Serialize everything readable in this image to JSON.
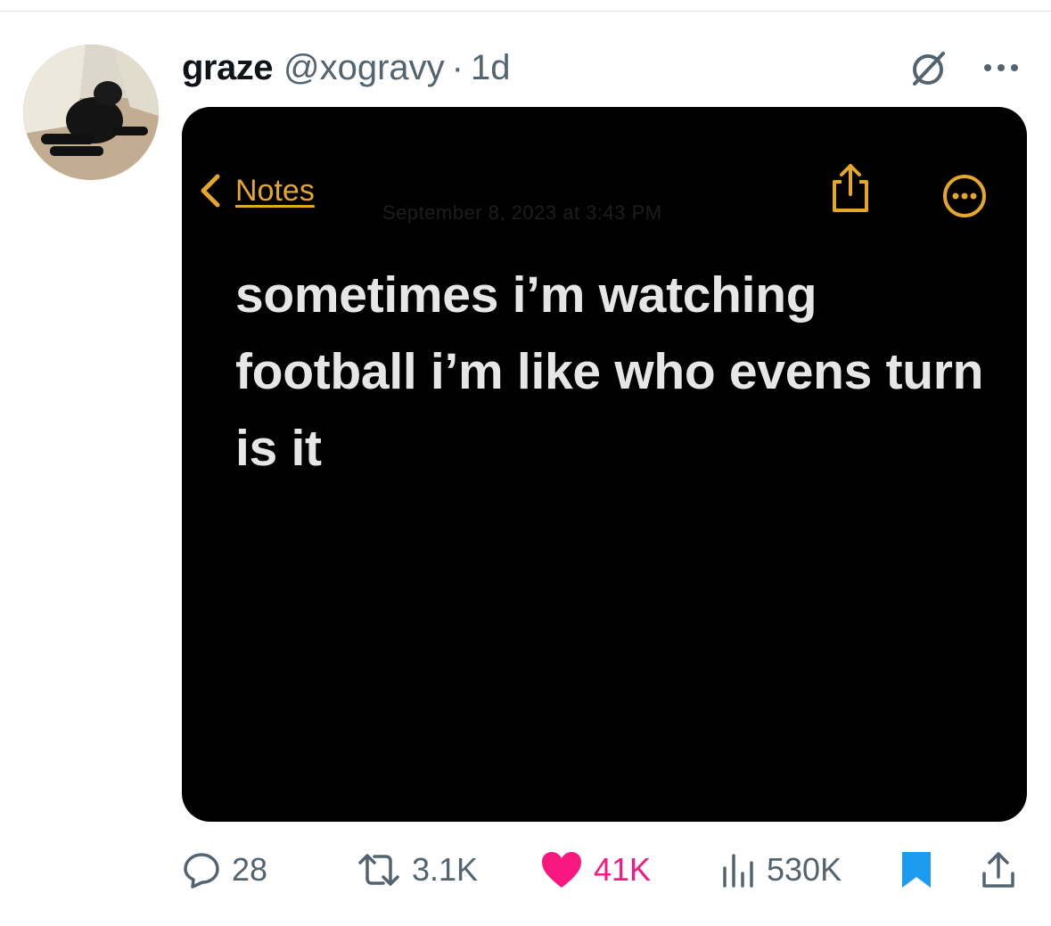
{
  "tweet": {
    "display_name": "graze",
    "handle": "@xogravy",
    "separator": "·",
    "time": "1d"
  },
  "note": {
    "back_label": "Notes",
    "faded_date": "September 8, 2023 at 3:43 PM",
    "text": "sometimes i’m watching football i’m like who evens turn is it",
    "accent_color": "#e5a72b"
  },
  "actions": {
    "replies": "28",
    "reposts": "3.1K",
    "likes": "41K",
    "views": "530K"
  },
  "colors": {
    "like": "#f91880",
    "bookmark": "#1d9bf0",
    "muted": "#536471"
  },
  "icons": [
    "grok-icon",
    "more-icon",
    "chevron-left-icon",
    "share-icon",
    "ellipsis-circle-icon",
    "reply-icon",
    "repost-icon",
    "heart-icon",
    "views-icon",
    "bookmark-icon",
    "share-icon"
  ]
}
